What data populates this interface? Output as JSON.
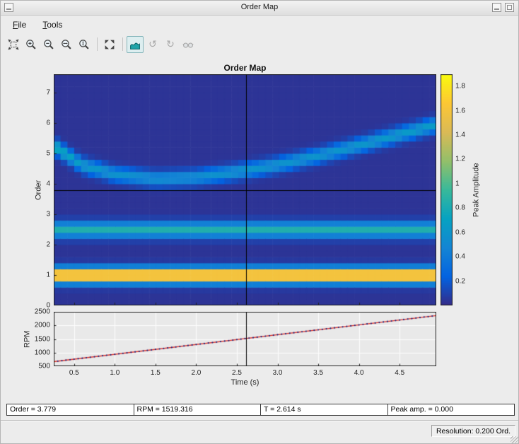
{
  "window": {
    "title": "Order Map",
    "menu": [
      {
        "label": "File"
      },
      {
        "label": "Tools"
      }
    ]
  },
  "toolbar": {
    "buttons": [
      {
        "icon": "fit-view-icon",
        "enabled": true
      },
      {
        "icon": "zoom-in-icon",
        "enabled": true
      },
      {
        "icon": "zoom-out-icon",
        "enabled": true
      },
      {
        "icon": "zoom-x-icon",
        "enabled": true
      },
      {
        "icon": "zoom-y-icon",
        "enabled": true
      },
      {
        "icon": "restore-view-icon",
        "enabled": true
      },
      {
        "icon": "surface-view-icon",
        "enabled": true,
        "pressed": true
      },
      {
        "icon": "rotate-ccw-icon",
        "enabled": false
      },
      {
        "icon": "rotate-cw-icon",
        "enabled": false
      },
      {
        "icon": "glasses-icon",
        "enabled": false
      }
    ]
  },
  "colors": {
    "toolbar_active_icon": "#1fa3a8",
    "crosshair": "#000000",
    "figure_background": "#ececec"
  },
  "cursor_readout": {
    "order": "Order = 3.779",
    "rpm": "RPM = 1519.316",
    "time": "T = 2.614 s",
    "peak": "Peak amp. = 0.000"
  },
  "status_bar": {
    "resolution": "Resolution: 0.200 Ord."
  },
  "chart_data": [
    {
      "type": "heatmap",
      "title": "Order Map",
      "xlabel": "Time (s)",
      "ylabel": "Order",
      "x_range": [
        0.25,
        4.95
      ],
      "y_range": [
        0,
        7.6
      ],
      "order_resolution": 0.2,
      "time_bins": 56,
      "amplitude_range": [
        0,
        1.9
      ],
      "background_amplitude": 0.04,
      "colormap": "parula",
      "colormap_stops": [
        "#352a87",
        "#0363e1",
        "#1485d4",
        "#06a2c2",
        "#38b99b",
        "#93bf6a",
        "#daba56",
        "#fdc735",
        "#f9fb0e"
      ],
      "constant_order_bands": [
        {
          "order": 1.0,
          "peak_amplitude": 1.85,
          "width_sigma": 0.17
        },
        {
          "order": 2.5,
          "peak_amplitude": 0.8,
          "width_sigma": 0.17
        }
      ],
      "order_track": {
        "t": [
          0.25,
          0.6,
          1.0,
          1.5,
          2.0,
          2.5,
          3.0,
          3.5,
          4.0,
          4.5,
          4.95
        ],
        "order": [
          5.25,
          4.62,
          4.32,
          4.17,
          4.22,
          4.4,
          4.63,
          4.93,
          5.27,
          5.63,
          5.95
        ],
        "peak_amplitude": [
          0.78,
          0.6,
          0.54,
          0.52,
          0.52,
          0.55,
          0.55,
          0.55,
          0.57,
          0.6,
          0.62
        ],
        "width_sigma": 0.16
      },
      "cursor": {
        "time": 2.614,
        "order": 3.779
      },
      "yticks": [
        "0",
        "1",
        "2",
        "3",
        "4",
        "5",
        "6",
        "7"
      ],
      "colorbar": {
        "label": "Peak Amplitude",
        "ticks": [
          "0.2",
          "0.4",
          "0.6",
          "0.8",
          "1",
          "1.2",
          "1.4",
          "1.6",
          "1.8"
        ]
      },
      "grid": false,
      "legend": "none"
    },
    {
      "type": "line",
      "xlabel": "Time (s)",
      "ylabel": "RPM",
      "x_range": [
        0.25,
        4.95
      ],
      "y_range": [
        500,
        2500
      ],
      "xticks": [
        "0.5",
        "1.0",
        "1.5",
        "2.0",
        "2.5",
        "3.0",
        "3.5",
        "4.0",
        "4.5"
      ],
      "yticks": [
        "500",
        "1000",
        "1500",
        "2000",
        "2500"
      ],
      "points": [
        {
          "t": 0.25,
          "rpm": 668
        },
        {
          "t": 4.95,
          "rpm": 2360
        }
      ],
      "marker_interval": 0.05,
      "line_color": "#e03127",
      "marker_color": "#1a237e",
      "cursor_time": 2.614,
      "grid": true,
      "legend": "none"
    }
  ]
}
